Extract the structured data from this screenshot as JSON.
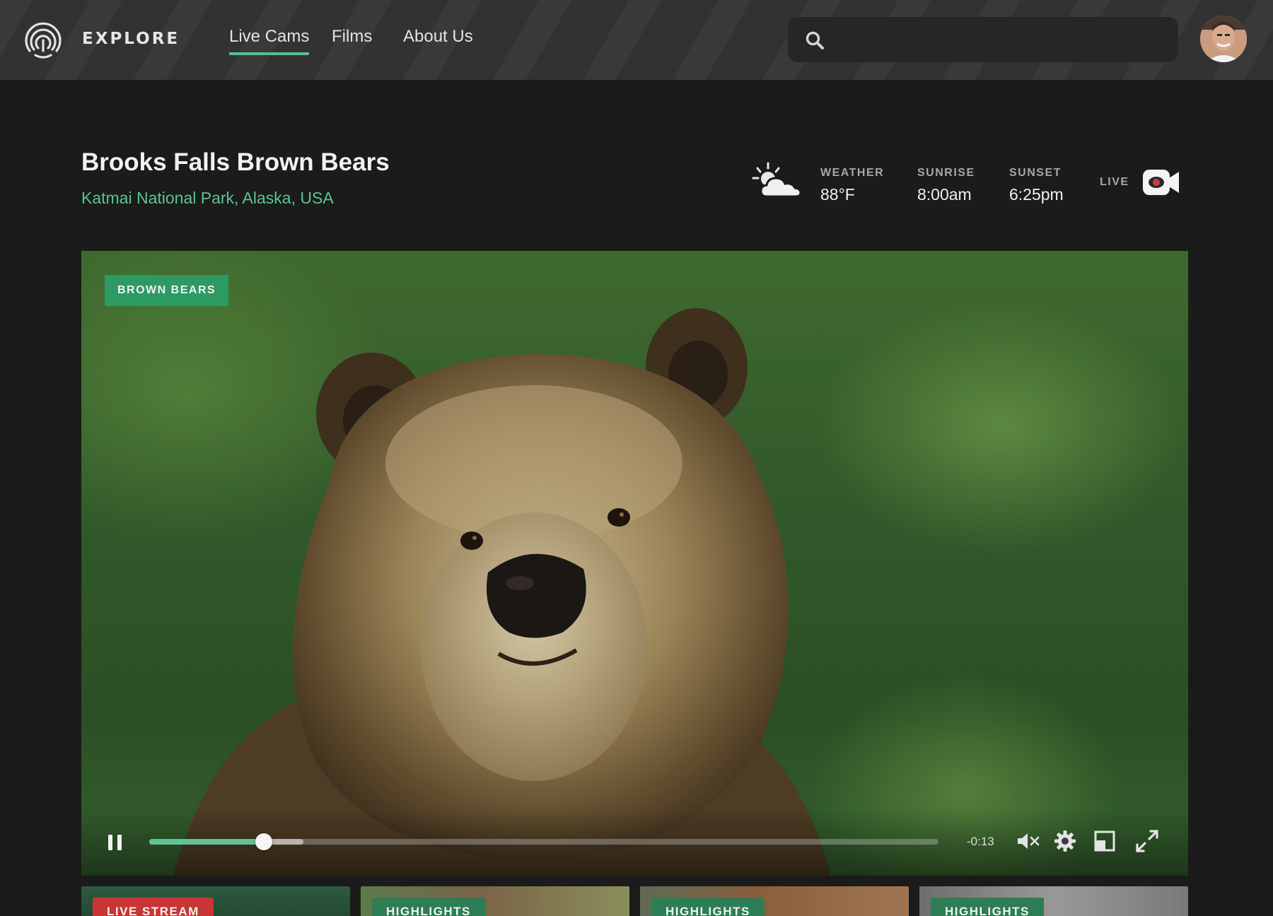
{
  "header": {
    "brand": "EXPLORE",
    "nav": [
      {
        "label": "Live Cams",
        "active": true
      },
      {
        "label": "Films",
        "active": false
      },
      {
        "label": "About Us",
        "active": false
      }
    ],
    "search": {
      "placeholder": "",
      "value": ""
    }
  },
  "cam": {
    "title": "Brooks Falls Brown Bears",
    "location": "Katmai National Park, Alaska, USA"
  },
  "stats": {
    "weather": {
      "label": "WEATHER",
      "value": "88°F",
      "icon": "partly-cloudy-icon"
    },
    "sunrise": {
      "label": "SUNRISE",
      "value": "8:00am"
    },
    "sunset": {
      "label": "SUNSET",
      "value": "6:25pm"
    },
    "live_label": "LIVE"
  },
  "player": {
    "category": "BROWN BEARS",
    "time_remaining": "-0:13",
    "progress_fraction": 0.145,
    "buffered_fraction": 0.195,
    "state": "playing",
    "muted": true
  },
  "thumbnails": [
    {
      "tag": "LIVE STREAM"
    },
    {
      "tag": "HIGHLIGHTS"
    },
    {
      "tag": "HIGHLIGHTS"
    },
    {
      "tag": "HIGHLIGHTS"
    }
  ],
  "colors": {
    "accent": "#5cc390",
    "badge_green": "#2d9a62",
    "live_red": "#d43a3a",
    "background": "#1b1b1b",
    "header": "#323232"
  }
}
